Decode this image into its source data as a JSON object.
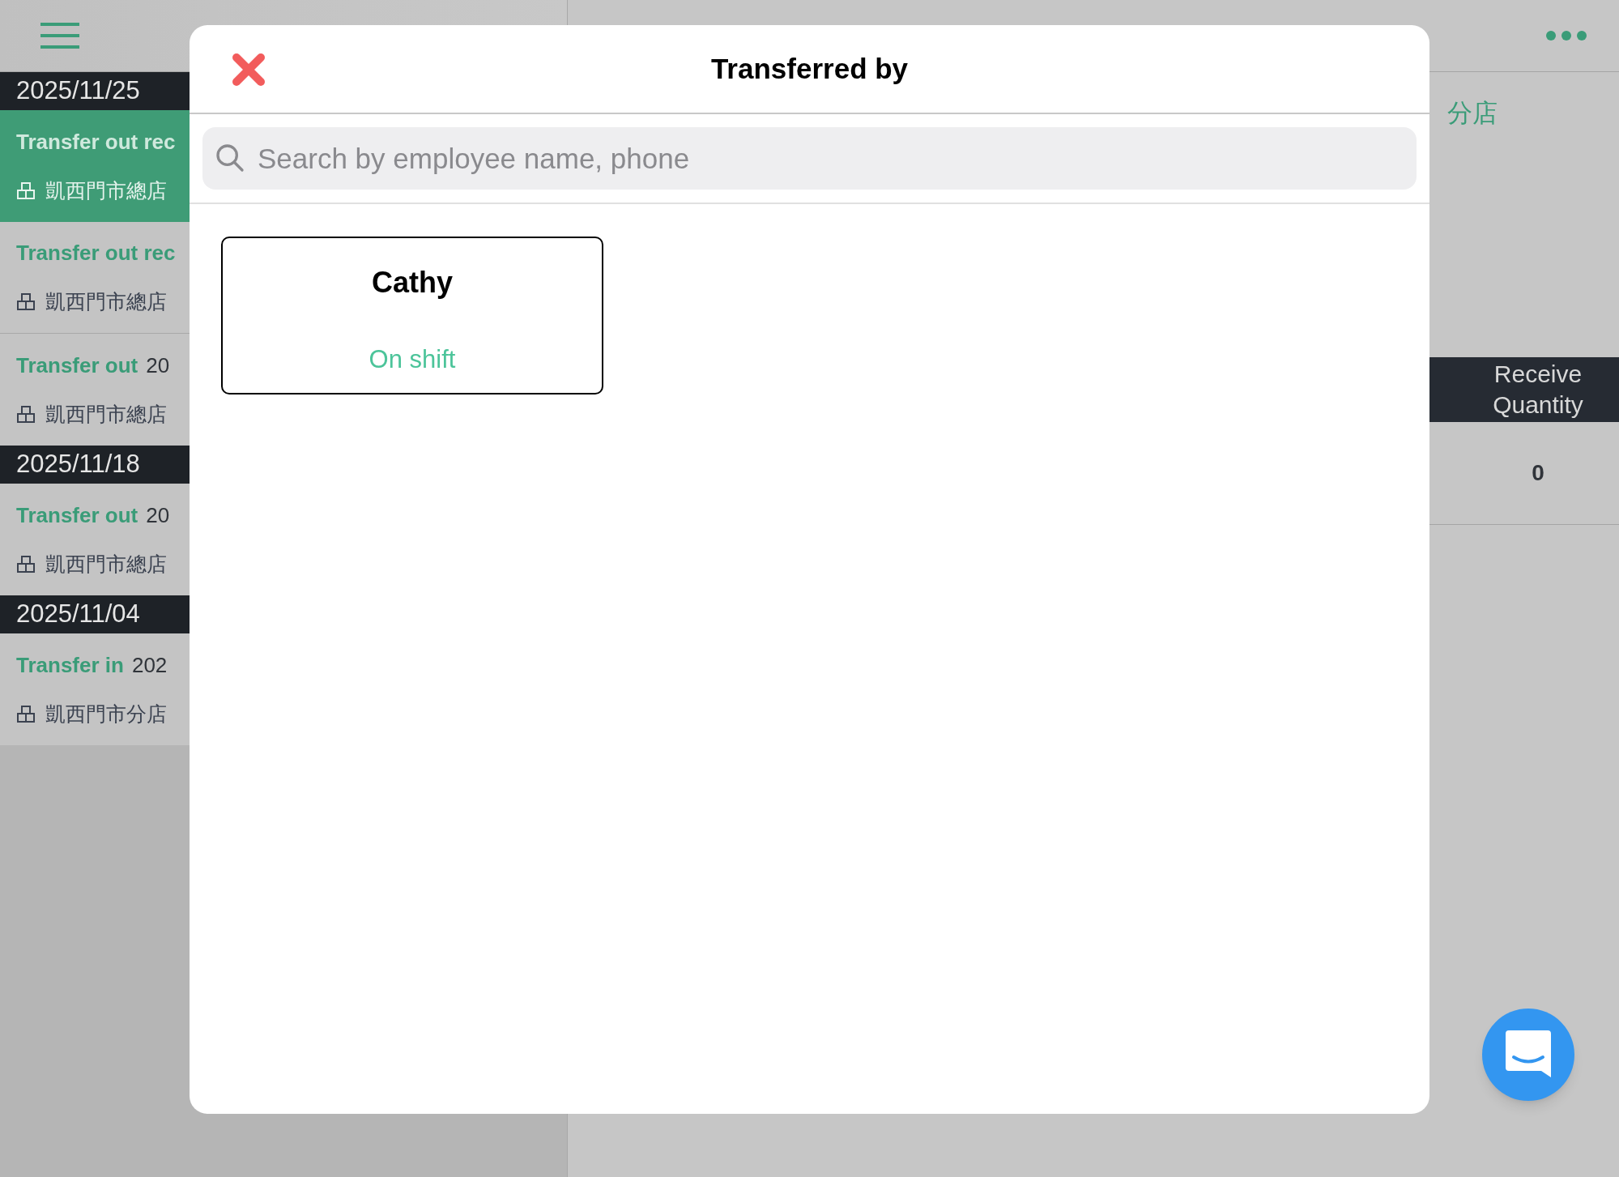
{
  "sidebar": {
    "groups": [
      {
        "date": "2025/11/25",
        "items": [
          {
            "type": "Transfer out rec",
            "store": "凱西門市總店",
            "selected": true
          },
          {
            "type": "Transfer out rec",
            "store": "凱西門市總店",
            "selected": false
          },
          {
            "type": "Transfer out",
            "number": "20",
            "store": "凱西門市總店",
            "selected": false
          }
        ]
      },
      {
        "date": "2025/11/18",
        "items": [
          {
            "type": "Transfer out",
            "number": "20",
            "store": "凱西門市總店",
            "selected": false
          }
        ]
      },
      {
        "date": "2025/11/04",
        "items": [
          {
            "type": "Transfer in",
            "number": "202",
            "store": "凱西門市分店",
            "selected": false
          }
        ]
      }
    ]
  },
  "detail": {
    "store_fragment": "分店",
    "table": {
      "columns": [
        "Receive Quantity"
      ],
      "rows": [
        [
          "0"
        ]
      ]
    }
  },
  "dialog": {
    "title": "Transferred by",
    "search": {
      "placeholder": "Search by employee name, phone"
    },
    "employees": [
      {
        "name": "Cathy",
        "status": "On shift"
      }
    ]
  }
}
